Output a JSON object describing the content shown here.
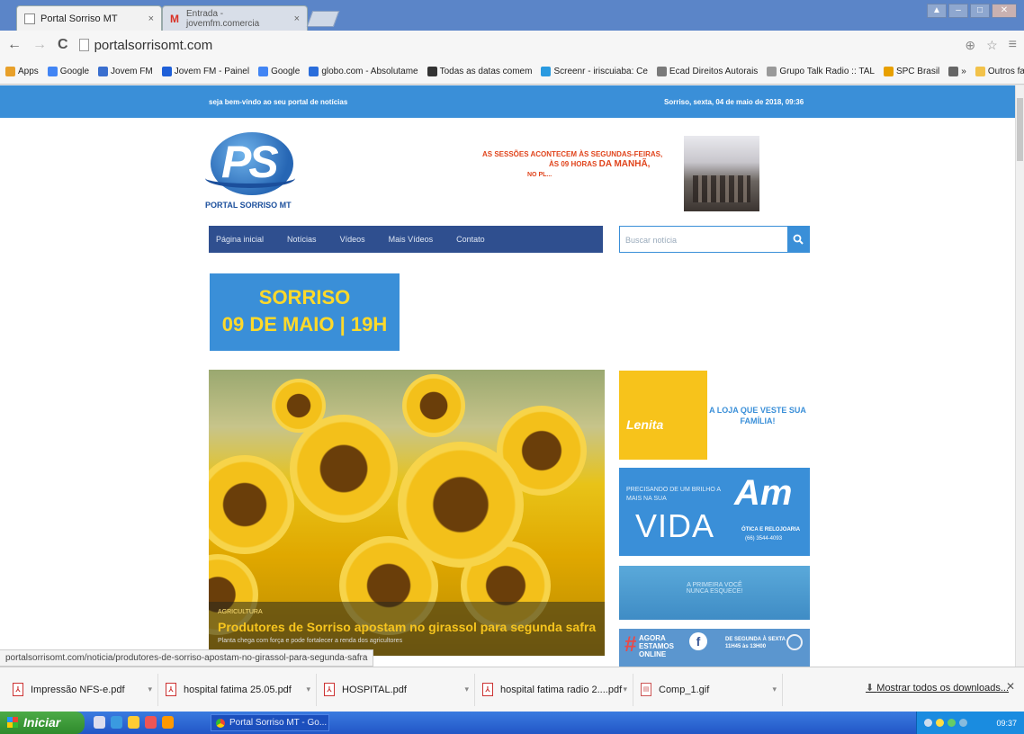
{
  "browser": {
    "tabs": [
      {
        "title": "Portal Sorriso MT",
        "close": "×"
      },
      {
        "title": "Entrada - jovemfm.comercia",
        "close": "×"
      }
    ],
    "url": "portalsorrisomt.com",
    "bookmarks": [
      {
        "label": "Apps",
        "icon": "apps-grid-icon",
        "color": "#e8a02a"
      },
      {
        "label": "Google",
        "icon": "google-icon",
        "color": "#4285f4"
      },
      {
        "label": "Jovem FM",
        "icon": "jovemfm-icon",
        "color": "#3a6fcf"
      },
      {
        "label": "Jovem FM - Painel",
        "icon": "jovemfm-painel-icon",
        "color": "#1e5fd8"
      },
      {
        "label": "Google",
        "icon": "google-icon",
        "color": "#4285f4"
      },
      {
        "label": "globo.com - Absolutame",
        "icon": "globo-icon",
        "color": "#2a6ddb"
      },
      {
        "label": "Todas as datas comem",
        "icon": "flag-icon",
        "color": "#333333"
      },
      {
        "label": "Screenr - iriscuiaba: Ce",
        "icon": "screenr-icon",
        "color": "#2a9ae0"
      },
      {
        "label": "Ecad Direitos Autorais",
        "icon": "ecad-icon",
        "color": "#7a7a7a"
      },
      {
        "label": "Grupo Talk Radio :: TAL",
        "icon": "talk-radio-icon",
        "color": "#999999"
      },
      {
        "label": "SPC Brasil",
        "icon": "spc-icon",
        "color": "#e8a000"
      },
      {
        "label": "»",
        "icon": "more-icon",
        "color": "#666666"
      },
      {
        "label": "Outros favoritos",
        "icon": "folder-icon",
        "color": "#f2c24a"
      }
    ]
  },
  "site": {
    "topbar": {
      "welcome": "seja bem-vindo ao seu portal de notícias",
      "date": "Sorriso, sexta, 04 de maio de 2018, 09:36"
    },
    "logo": {
      "letters": "PS",
      "name": "PORTAL SORRISO MT"
    },
    "banner": {
      "line1": "AS SESSÕES ACONTECEM ÀS SEGUNDAS-FEIRAS,",
      "line2a": "ÀS 09 HORAS",
      "line2b": "DA MANHÃ,",
      "line3": "NO PL..."
    },
    "menu": [
      "Página inicial",
      "Notícias",
      "Vídeos",
      "Mais Vídeos",
      "Contato"
    ],
    "search_placeholder": "Buscar notícia",
    "search_icon": "magnifier-icon",
    "event": {
      "line1": "SORRISO",
      "line2": "09 DE MAIO | 19H"
    },
    "headline": {
      "category": "AGRICULTURA",
      "title": "Produtores de Sorriso apostam no girassol para segunda safra",
      "subtitle": "Planta chega com força e pode fortalecer a renda dos agricultores"
    },
    "ads": {
      "lenita": {
        "brand": "Lenita",
        "slogan": "A LOJA QUE VESTE SUA FAMÍLIA!"
      },
      "am": {
        "question": "PRECISANDO DE UM BRILHO A MAIS NA SUA",
        "vida": "VIDA",
        "logo": "Am",
        "shop": "ÓTICA E RELOJOARIA",
        "phone": "(66) 3544-4093"
      },
      "third": {
        "line1": "A PRIMEIRA VOCÊ",
        "line2": "NUNCA ESQUECE!"
      },
      "fourth": {
        "hash": "#",
        "line1": "AGORA",
        "line2": "ESTAMOS",
        "line3": "ONLINE",
        "info1": "DE SEGUNDA À SEXTA",
        "info2": "11H45 às 13H00"
      }
    }
  },
  "status_url": "portalsorrisomt.com/noticia/produtores-de-sorriso-apostam-no-girassol-para-segunda-safra",
  "downloads": [
    {
      "name": "Impressão NFS-e.pdf",
      "type": "pdf"
    },
    {
      "name": "hospital fatima 25.05.pdf",
      "type": "pdf"
    },
    {
      "name": "HOSPITAL.pdf",
      "type": "pdf"
    },
    {
      "name": "hospital fatima radio 2....pdf",
      "type": "pdf"
    },
    {
      "name": "Comp_1.gif",
      "type": "gif"
    }
  ],
  "download_show_all": "Mostrar todos os downloads...",
  "taskbar": {
    "start": "Iniciar",
    "task": "Portal Sorriso MT - Go...",
    "clock": "09:37"
  }
}
